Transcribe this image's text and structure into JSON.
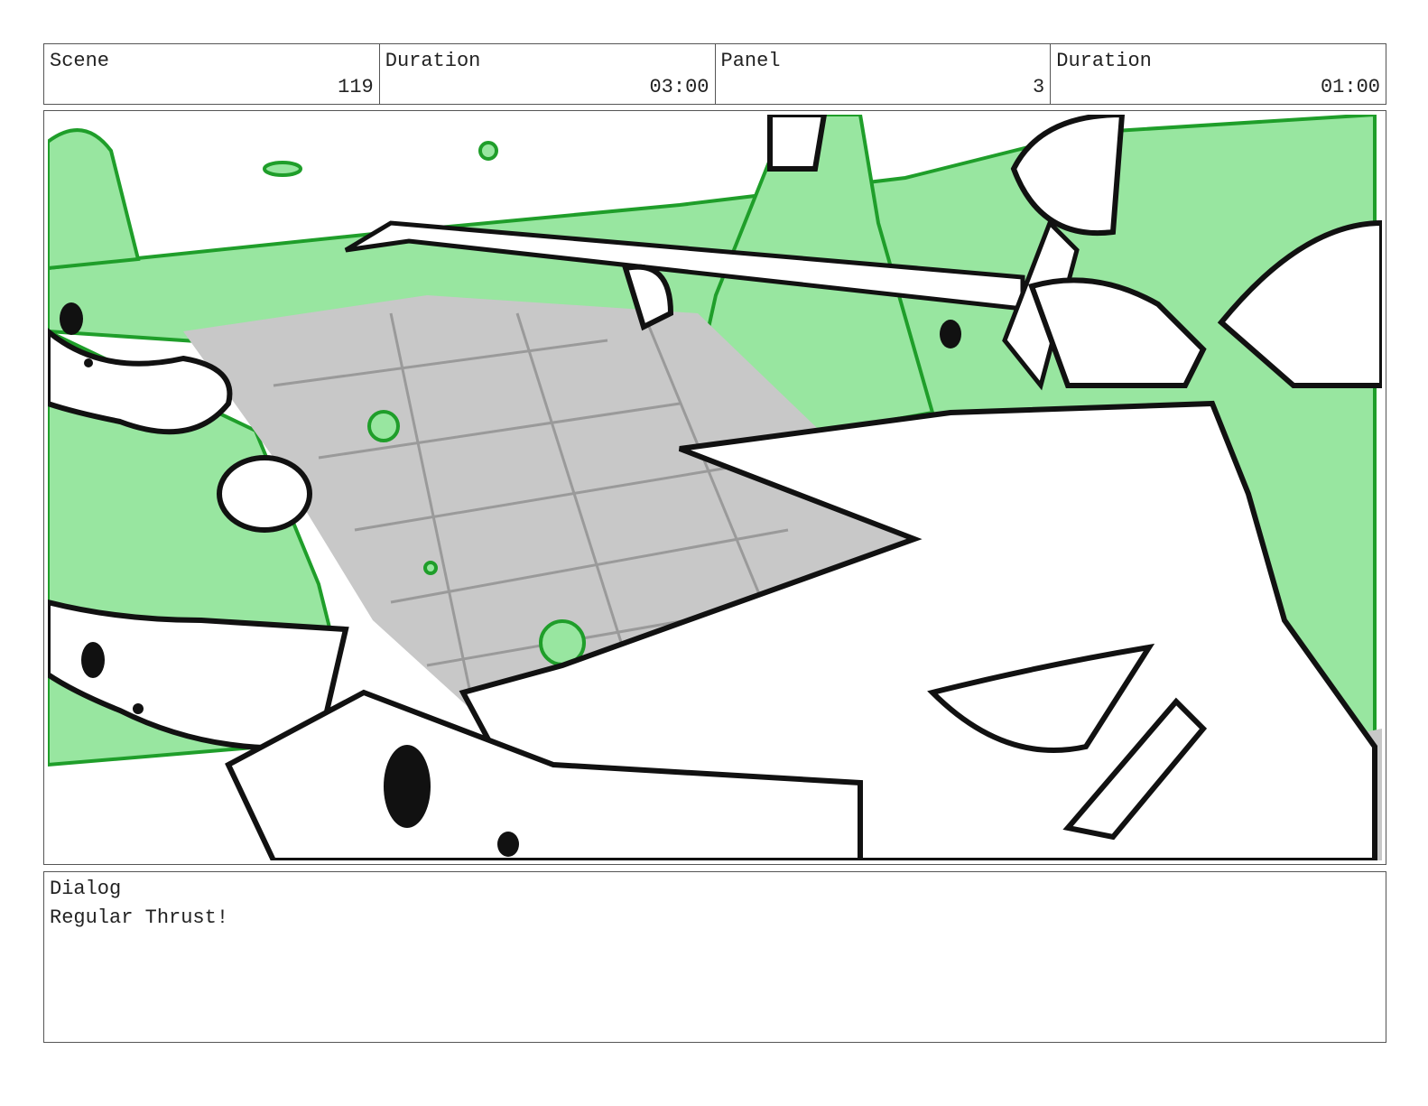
{
  "header": {
    "cells": [
      {
        "label": "Scene",
        "value": "119"
      },
      {
        "label": "Duration",
        "value": "03:00"
      },
      {
        "label": "Panel",
        "value": "3"
      },
      {
        "label": "Duration",
        "value": "01:00"
      }
    ]
  },
  "panel": {
    "colors": {
      "green_fill": "#98e6a0",
      "green_line": "#1f9e2a",
      "gray_floor": "#c8c8c8",
      "ink": "#111111"
    }
  },
  "dialog": {
    "label": "Dialog",
    "text": "Regular Thrust!"
  }
}
